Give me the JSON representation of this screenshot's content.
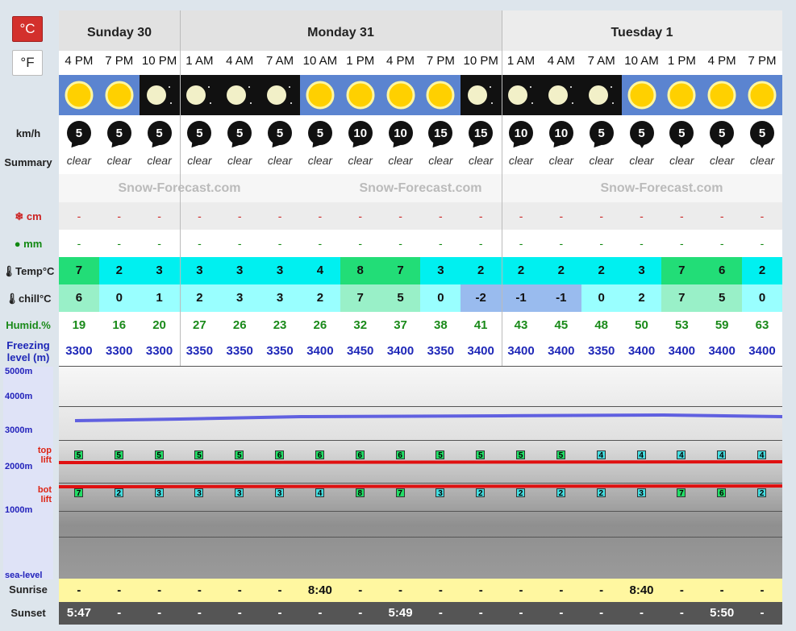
{
  "units": {
    "c": "°C",
    "f": "°F"
  },
  "labels": {
    "wind": "km/h",
    "summary": "Summary",
    "snow": "cm",
    "rain": "mm",
    "temp": "Temp°C",
    "chill": "chill°C",
    "humid": "Humid.%",
    "freezing": "Freezing level (m)",
    "top": "top lift",
    "bot": "bot lift",
    "sunrise": "Sunrise",
    "sunset": "Sunset"
  },
  "days": [
    {
      "name": "Sunday 30"
    },
    {
      "name": "Monday 31"
    },
    {
      "name": "Tuesday 1"
    }
  ],
  "times": [
    "4 PM",
    "7 PM",
    "10 PM",
    "1 AM",
    "4 AM",
    "7 AM",
    "10 AM",
    "1 PM",
    "4 PM",
    "7 PM",
    "10 PM",
    "1 AM",
    "4 AM",
    "7 AM",
    "10 AM",
    "1 PM",
    "4 PM",
    "7 PM"
  ],
  "icons": [
    "sun",
    "sun",
    "moon",
    "moon",
    "moon",
    "moon",
    "sun",
    "sun",
    "sun",
    "sun",
    "moon",
    "moon",
    "moon",
    "moon",
    "sun",
    "sun",
    "sun",
    "sun"
  ],
  "wind": [
    "5",
    "5",
    "5",
    "5",
    "5",
    "5",
    "5",
    "10",
    "10",
    "15",
    "15",
    "10",
    "10",
    "5",
    "5",
    "5",
    "5",
    "5"
  ],
  "summary": [
    "clear",
    "clear",
    "clear",
    "clear",
    "clear",
    "clear",
    "clear",
    "clear",
    "clear",
    "clear",
    "clear",
    "clear",
    "clear",
    "clear",
    "clear",
    "clear",
    "clear",
    "clear"
  ],
  "watermark": "Snow-Forecast.com",
  "snow": [
    "-",
    "-",
    "-",
    "-",
    "-",
    "-",
    "-",
    "-",
    "-",
    "-",
    "-",
    "-",
    "-",
    "-",
    "-",
    "-",
    "-",
    "-"
  ],
  "rain": [
    "-",
    "-",
    "-",
    "-",
    "-",
    "-",
    "-",
    "-",
    "-",
    "-",
    "-",
    "-",
    "-",
    "-",
    "-",
    "-",
    "-",
    "-"
  ],
  "temp": [
    "7",
    "2",
    "3",
    "3",
    "3",
    "3",
    "4",
    "8",
    "7",
    "3",
    "2",
    "2",
    "2",
    "2",
    "3",
    "7",
    "6",
    "2"
  ],
  "chill": [
    "6",
    "0",
    "1",
    "2",
    "3",
    "3",
    "2",
    "7",
    "5",
    "0",
    "-2",
    "-1",
    "-1",
    "0",
    "2",
    "7",
    "5",
    "0"
  ],
  "humid": [
    "19",
    "16",
    "20",
    "27",
    "26",
    "23",
    "26",
    "32",
    "37",
    "38",
    "41",
    "43",
    "45",
    "48",
    "50",
    "53",
    "59",
    "63"
  ],
  "freezing": [
    "3300",
    "3300",
    "3300",
    "3350",
    "3350",
    "3350",
    "3400",
    "3450",
    "3400",
    "3350",
    "3400",
    "3400",
    "3400",
    "3350",
    "3400",
    "3400",
    "3400",
    "3400"
  ],
  "alt": [
    "5000m",
    "4000m",
    "3000m",
    "2000m",
    "1000m",
    "sea-level"
  ],
  "toplift": [
    "5",
    "5",
    "5",
    "5",
    "5",
    "6",
    "6",
    "6",
    "6",
    "5",
    "5",
    "5",
    "5",
    "4",
    "4",
    "4",
    "4",
    "4"
  ],
  "botlift": [
    "7",
    "2",
    "3",
    "3",
    "3",
    "3",
    "4",
    "8",
    "7",
    "3",
    "2",
    "2",
    "2",
    "2",
    "3",
    "7",
    "6",
    "2"
  ],
  "sunrise": [
    "-",
    "-",
    "-",
    "-",
    "-",
    "-",
    "8:40",
    "-",
    "-",
    "-",
    "-",
    "-",
    "-",
    "-",
    "8:40",
    "-",
    "-",
    "-"
  ],
  "sunset": [
    "5:47",
    "-",
    "-",
    "-",
    "-",
    "-",
    "-",
    "-",
    "5:49",
    "-",
    "-",
    "-",
    "-",
    "-",
    "-",
    "-",
    "5:50",
    "-"
  ],
  "colors": {
    "temp_warm": "#22dd77",
    "temp_cool": "#00f0f0",
    "chill_warm": "#99f0c8",
    "chill_cool": "#99ffff",
    "chill_cold": "#99bbee"
  }
}
